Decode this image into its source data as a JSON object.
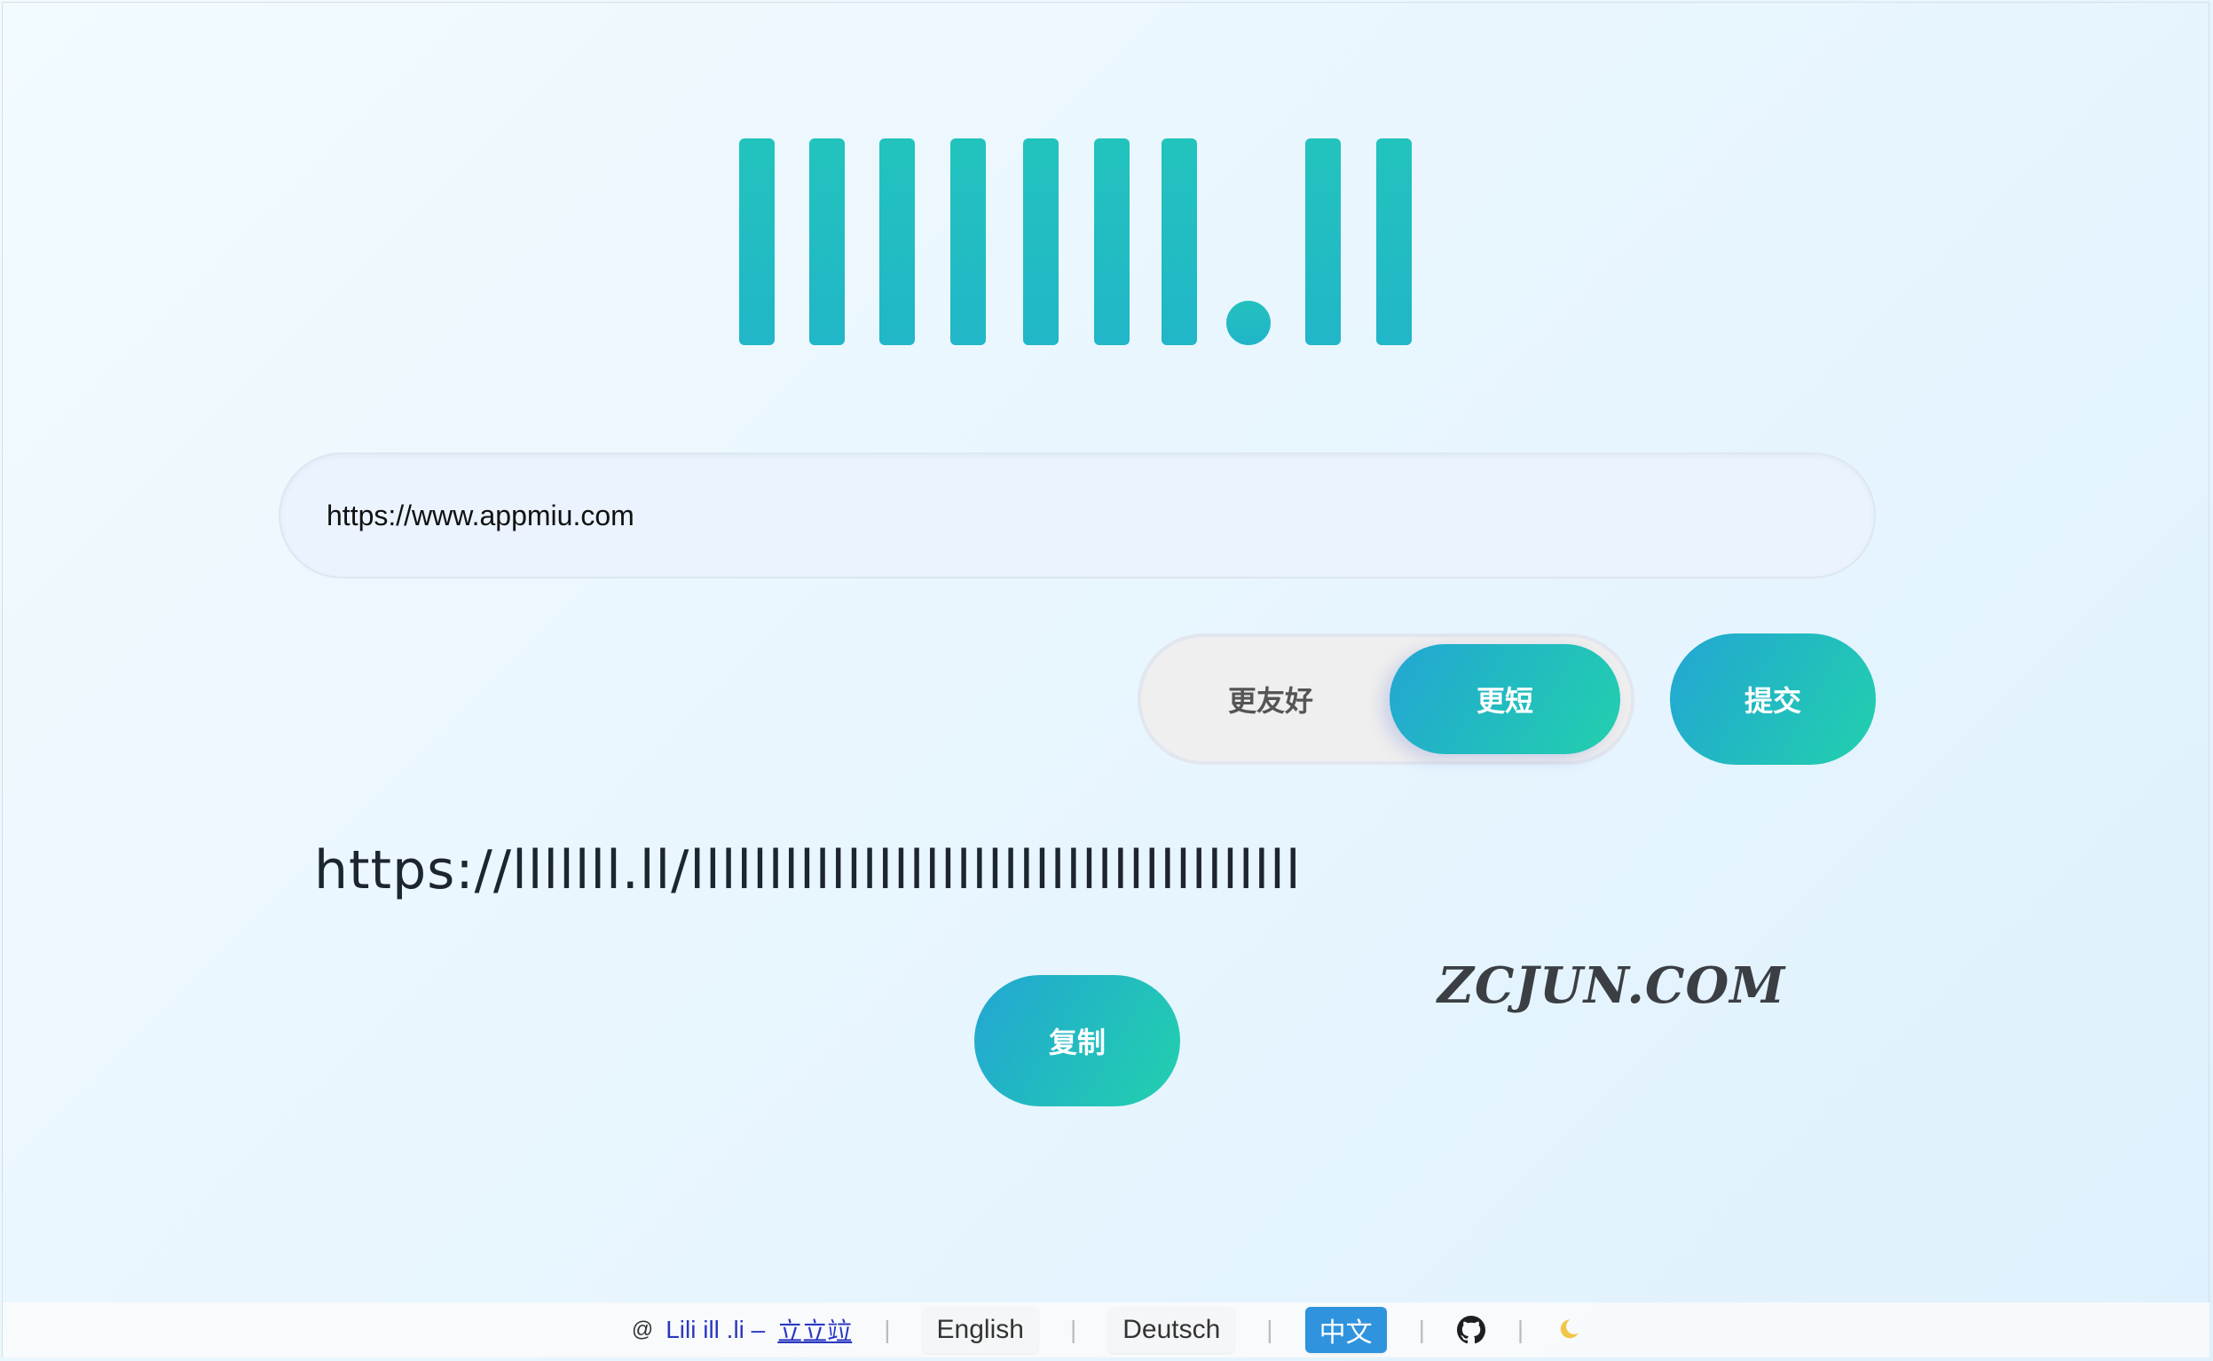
{
  "logo": {
    "text": "llllll.ll"
  },
  "url_input": {
    "value": "https://www.appmiu.com"
  },
  "mode_toggle": {
    "options": [
      {
        "label": "更友好",
        "selected": false
      },
      {
        "label": "更短",
        "selected": true
      }
    ]
  },
  "submit": {
    "label": "提交"
  },
  "result": {
    "short_url": "https://lllllll.ll/lllllllllllllllllllllllllllllllllllllll"
  },
  "copy": {
    "label": "复制"
  },
  "watermark": {
    "text": "ZCJUN.COM"
  },
  "footer": {
    "copyright_symbol": "@",
    "brand": "Lili ill .li –",
    "brand_link": "立立竝",
    "languages": [
      {
        "label": "English",
        "active": false
      },
      {
        "label": "Deutsch",
        "active": false
      },
      {
        "label": "中文",
        "active": true
      }
    ],
    "github_icon": "github-icon",
    "theme_icon": "moon-icon",
    "moon_color": "#f1c64a"
  },
  "colors": {
    "accent_start": "#22a6d3",
    "accent_end": "#22d0ad",
    "logo": "#22bcc3",
    "active_lang": "#2f93dd"
  }
}
